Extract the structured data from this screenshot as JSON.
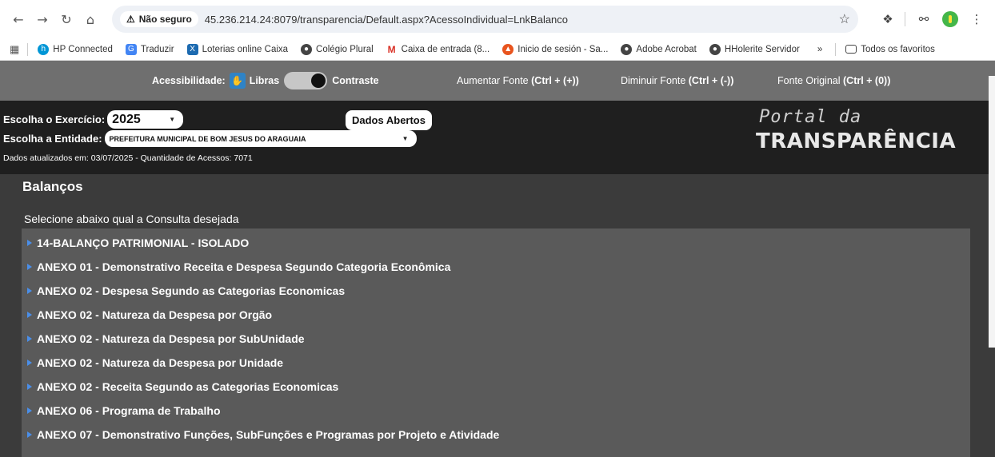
{
  "browser": {
    "security_label": "Não seguro",
    "url": "45.236.214.24:8079/transparencia/Default.aspx?AcessoIndividual=LnkBalanco",
    "bookmarks": [
      {
        "label": "HP Connected",
        "icon": "hp-icon",
        "color": "#0096d6"
      },
      {
        "label": "Traduzir",
        "icon": "translate-icon",
        "color": "#4285f4"
      },
      {
        "label": "Loterias online Caixa",
        "icon": "caixa-icon",
        "color": "#1c6ab0"
      },
      {
        "label": "Colégio Plural",
        "icon": "globe-icon",
        "color": "#444444"
      },
      {
        "label": "Caixa de entrada (8...",
        "icon": "gmail-icon",
        "color": "#d93025"
      },
      {
        "label": "Inicio de sesión - Sa...",
        "icon": "flame-icon",
        "color": "#e8541e"
      },
      {
        "label": "Adobe Acrobat",
        "icon": "globe-icon",
        "color": "#444444"
      },
      {
        "label": "HHolerite Servidor",
        "icon": "globe-icon",
        "color": "#444444"
      }
    ],
    "more_label": "»",
    "all_bookmarks_label": "Todos os favoritos"
  },
  "accessibility": {
    "label": "Acessibilidade:",
    "libras": "Libras",
    "contrast": "Contraste",
    "increase_label": "Aumentar Fonte",
    "increase_shortcut": "(Ctrl + (+))",
    "decrease_label": "Diminuir Fonte",
    "decrease_shortcut": "(Ctrl + (-))",
    "original_label": "Fonte Original",
    "original_shortcut": "(Ctrl + (0))"
  },
  "header": {
    "exercise_label": "Escolha o Exercício:",
    "exercise_value": "2025",
    "entity_label": "Escolha a Entidade:",
    "entity_value": "PREFEITURA MUNICIPAL DE BOM JESUS DO ARAGUAIA",
    "open_data_button": "Dados Abertos",
    "updated_text": "Dados atualizados em: 03/07/2025 - Quantidade de Acessos: 7071",
    "portal_line1": "Portal da",
    "portal_line2": "TRANSPARÊNCIA"
  },
  "main": {
    "title": "Balanços",
    "subtitle": "Selecione abaixo qual a Consulta desejada",
    "items": [
      "14-BALANÇO PATRIMONIAL - ISOLADO",
      "ANEXO 01 - Demonstrativo Receita e Despesa Segundo Categoria Econômica",
      "ANEXO 02 - Despesa Segundo as Categorias Economicas",
      "ANEXO 02 - Natureza da Despesa por Orgão",
      "ANEXO 02 - Natureza da Despesa por SubUnidade",
      "ANEXO 02 - Natureza da Despesa por Unidade",
      "ANEXO 02 - Receita Segundo as Categorias Economicas",
      "ANEXO 06 - Programa de Trabalho",
      "ANEXO 07 - Demonstrativo Funções, SubFunções e Programas por Projeto e Atividade"
    ]
  }
}
